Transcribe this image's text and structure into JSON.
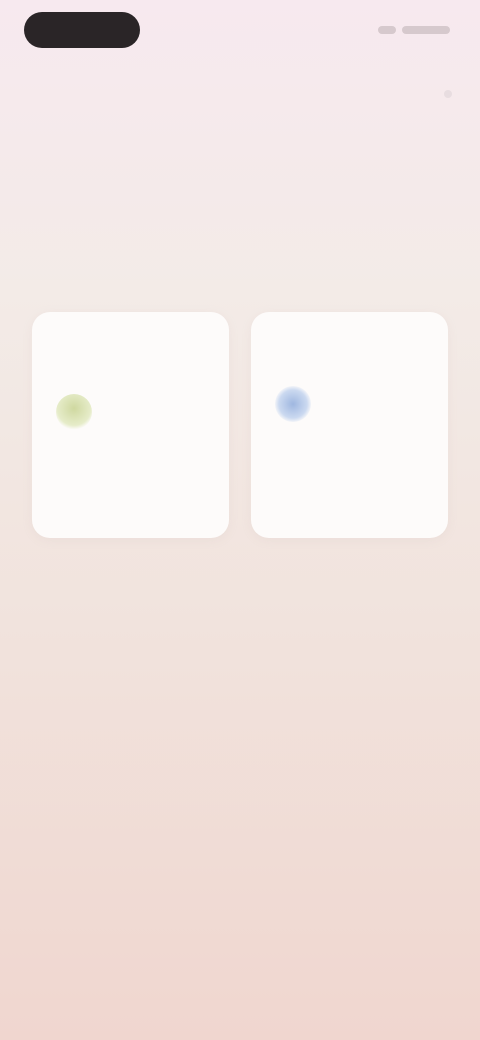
{
  "status_bar": {
    "icons": [
      "signal-icon",
      "battery-icon"
    ]
  },
  "subnav": {
    "breadcrumb": ""
  },
  "header": {
    "title": "",
    "subtitle": ""
  },
  "cards": [
    {
      "icon": "leaf-icon",
      "title": "",
      "description": ""
    },
    {
      "icon": "cloud-icon",
      "title": "",
      "description": ""
    }
  ],
  "colors": {
    "accent_pink": "#e2bfc3",
    "dark": "#2a2527",
    "card_bg": "#fdfbfa",
    "leaf": "#cfd8a0",
    "cloud": "#9fb7e0"
  }
}
